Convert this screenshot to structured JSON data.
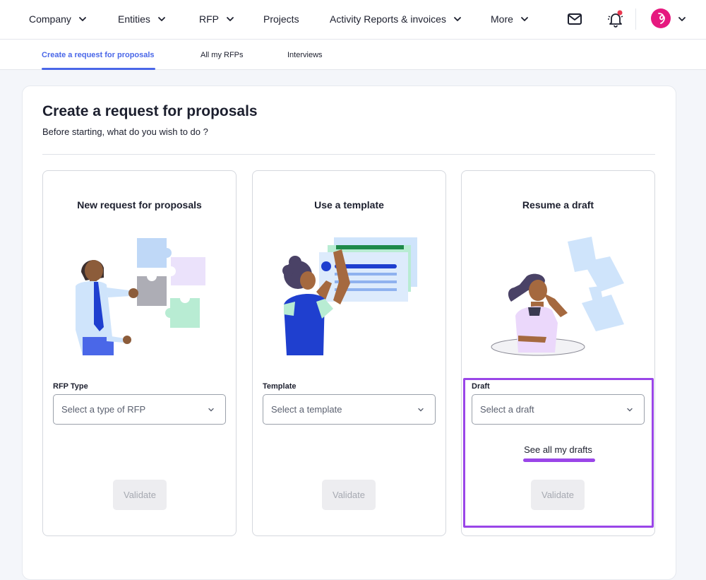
{
  "nav": {
    "items": [
      {
        "label": "Company",
        "has_chevron": true
      },
      {
        "label": "Entities",
        "has_chevron": true
      },
      {
        "label": "RFP",
        "has_chevron": true
      },
      {
        "label": "Projects",
        "has_chevron": false
      },
      {
        "label": "Activity Reports & invoices",
        "has_chevron": true
      },
      {
        "label": "More",
        "has_chevron": true
      }
    ],
    "icons": [
      "mail-icon",
      "bell-icon",
      "avatar"
    ],
    "notification_dot_color": "#e8384f",
    "avatar_color": "#e6197f"
  },
  "tabs": [
    {
      "label": "Create a request for proposals",
      "active": true
    },
    {
      "label": "All my RFPs",
      "active": false
    },
    {
      "label": "Interviews",
      "active": false
    }
  ],
  "page": {
    "title": "Create a request for proposals",
    "subtitle": "Before starting, what do you wish to do ?"
  },
  "options": [
    {
      "title": "New request for proposals",
      "field_label": "RFP Type",
      "placeholder": "Select a type of RFP",
      "validate_label": "Validate",
      "illustration": "person-with-puzzle-pieces"
    },
    {
      "title": "Use a template",
      "field_label": "Template",
      "placeholder": "Select a template",
      "validate_label": "Validate",
      "illustration": "person-reaching-document-templates"
    },
    {
      "title": "Resume a draft",
      "field_label": "Draft",
      "placeholder": "Select a draft",
      "link_label": "See all my drafts",
      "validate_label": "Validate",
      "illustration": "person-with-flying-papers"
    }
  ],
  "colors": {
    "accent": "#4a67e8",
    "highlight": "#9a46e8",
    "disabled_bg": "#ededf0",
    "disabled_text": "#a6a9b1"
  }
}
